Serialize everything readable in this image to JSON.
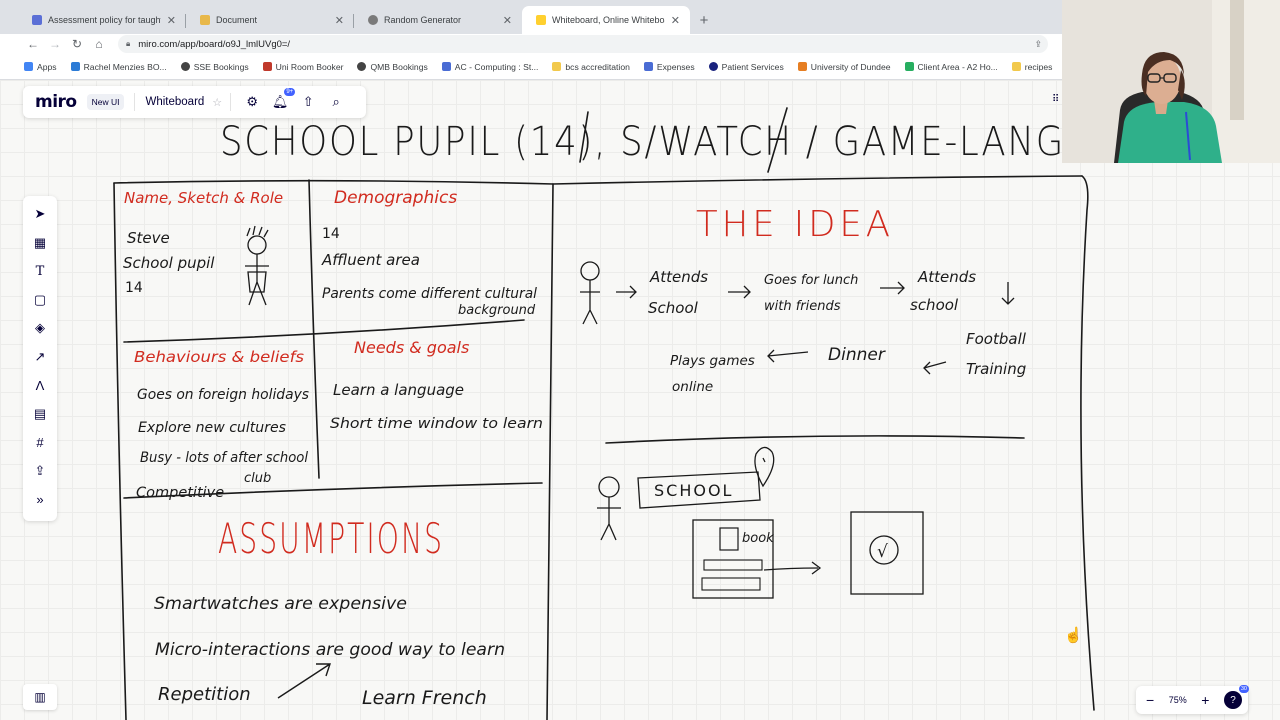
{
  "browser": {
    "tabs": [
      {
        "label": "Assessment policy for taught pro",
        "favicon_color": "#5b6fd6",
        "active": false
      },
      {
        "label": "Document",
        "favicon_color": "#e8b84a",
        "active": false
      },
      {
        "label": "Random Generator",
        "favicon_color": "#7a7a7a",
        "active": false
      },
      {
        "label": "Whiteboard, Online Whiteboard",
        "favicon_color": "#ffd02f",
        "active": true
      }
    ],
    "url": "miro.com/app/board/o9J_lmlUVg0=/",
    "bookmarks": [
      {
        "label": "Apps",
        "color": "#4285f4"
      },
      {
        "label": "Rachel Menzies BO...",
        "color": "#2b7bd6"
      },
      {
        "label": "SSE Bookings",
        "color": "#444444"
      },
      {
        "label": "Uni Room Booker",
        "color": "#c0392b"
      },
      {
        "label": "QMB Bookings",
        "color": "#444444"
      },
      {
        "label": "AC - Computing : St...",
        "color": "#4a6cd4"
      },
      {
        "label": "bcs accreditation",
        "color": "#f2c94c"
      },
      {
        "label": "Expenses",
        "color": "#4a6cd4"
      },
      {
        "label": "Patient Services",
        "color": "#1a237e"
      },
      {
        "label": "University of Dundee",
        "color": "#e67e22"
      },
      {
        "label": "Client Area - A2 Ho...",
        "color": "#27ae60"
      },
      {
        "label": "recipes",
        "color": "#f2c94c"
      }
    ]
  },
  "miro": {
    "logo": "miro",
    "new_ui": "New UI",
    "board_name": "Whiteboard",
    "notif_count": "9+",
    "zoom": "75%",
    "help_badge": "30",
    "toolbar_icons": [
      "select-icon",
      "template-icon",
      "text-icon",
      "sticky-note-icon",
      "shapes-icon",
      "arrow-icon",
      "pen-icon",
      "comment-icon",
      "frame-icon",
      "upload-icon",
      "more-icon"
    ]
  },
  "board": {
    "heading": "SCHOOL PUPIL (14), S/WATCH / GAME-LANG",
    "name_sketch_role": {
      "title": "Name, Sketch & Role",
      "lines": [
        "Steve",
        "School pupil",
        "14"
      ]
    },
    "demographics": {
      "title": "Demographics",
      "lines": [
        "14",
        "Affluent area",
        "Parents come different cultural",
        "background"
      ]
    },
    "behaviours": {
      "title": "Behaviours & beliefs",
      "lines": [
        "Goes on foreign holidays",
        "Explore new cultures",
        "Busy - lots of after school",
        "club",
        "Competitive"
      ]
    },
    "needs": {
      "title": "Needs & goals",
      "lines": [
        "Learn a language",
        "Short time window to learn"
      ]
    },
    "assumptions": {
      "title": "ASSUMPTIONS",
      "lines": [
        "Smartwatches are expensive",
        "Micro-interactions are good way to learn",
        "Repetition",
        "Learn French"
      ]
    },
    "idea": {
      "title": "THE IDEA",
      "flow": [
        "Attends School",
        "Goes for lunch with friends",
        "Attends school",
        "Football Training",
        "Dinner",
        "Plays games online"
      ],
      "school_label": "SCHOOL",
      "book_label": "book",
      "tick": "√"
    }
  },
  "colors": {
    "ink": "#1a1a1a",
    "red_ink": "#d12b1f",
    "miro_blue": "#4262ff",
    "miro_navy": "#050038"
  }
}
